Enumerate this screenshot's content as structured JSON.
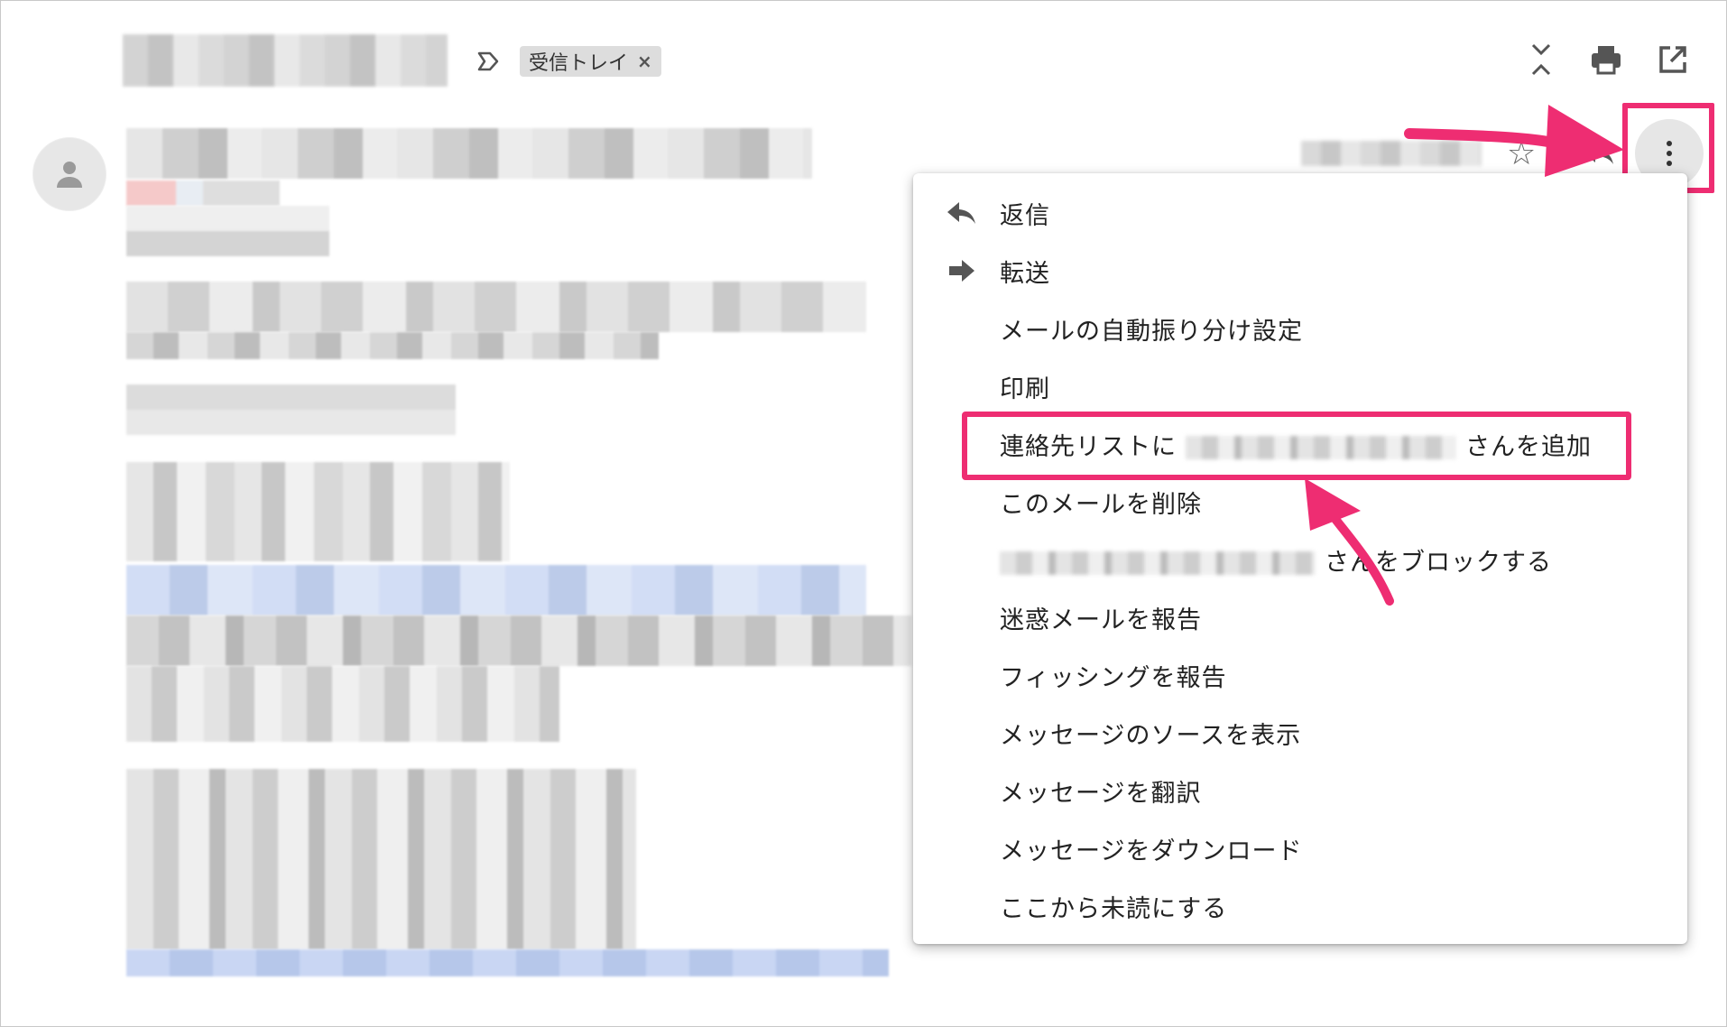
{
  "header": {
    "label_chip": "受信トレイ",
    "chip_close": "×"
  },
  "icons": {
    "label": "label-icon",
    "expand": "unfold-icon",
    "print": "print-icon",
    "popout": "open-in-new-icon",
    "avatar": "person-icon",
    "star": "star-outline-icon",
    "reply": "reply-icon",
    "more": "more-vert-icon",
    "forward": "forward-icon"
  },
  "star_glyph": "☆",
  "menu": {
    "items": [
      {
        "label": "返信"
      },
      {
        "label": "転送"
      },
      {
        "label": "メールの自動振り分け設定"
      },
      {
        "label": "印刷"
      },
      {
        "prefix": "連絡先リストに",
        "suffix": "さんを追加"
      },
      {
        "label": "このメールを削除"
      },
      {
        "suffix": "さんをブロックする"
      },
      {
        "label": "迷惑メールを報告"
      },
      {
        "label": "フィッシングを報告"
      },
      {
        "label": "メッセージのソースを表示"
      },
      {
        "label": "メッセージを翻訳"
      },
      {
        "label": "メッセージをダウンロード"
      },
      {
        "label": "ここから未読にする"
      }
    ]
  },
  "colors": {
    "highlight": "#ee2d72",
    "menu_bg": "#ffffff",
    "chip_bg": "#dddddd"
  }
}
